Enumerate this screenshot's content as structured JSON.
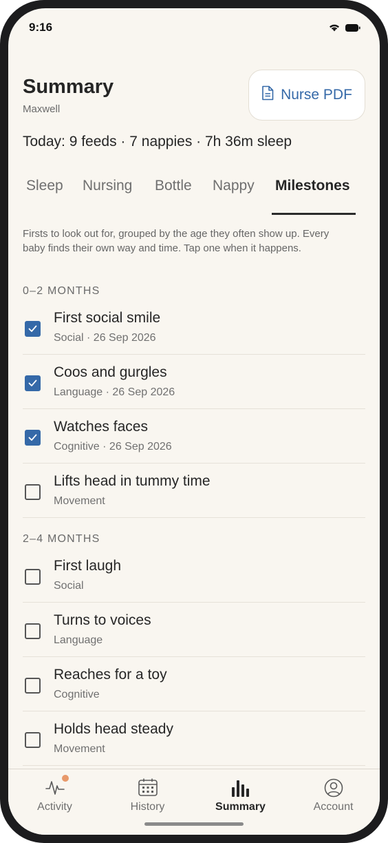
{
  "status": {
    "time": "9:16"
  },
  "header": {
    "title": "Summary",
    "subtitle": "Maxwell",
    "pdf_button": "Nurse PDF",
    "today": "Today: 9 feeds · 7 nappies · 7h 36m sleep"
  },
  "tabs": [
    {
      "label": "Sleep"
    },
    {
      "label": "Nursing"
    },
    {
      "label": "Bottle"
    },
    {
      "label": "Nappy"
    },
    {
      "label": "Milestones",
      "active": true
    }
  ],
  "intro": "Firsts to look out for, grouped by the age they often show up. Every baby finds their own way and time. Tap one when it happens.",
  "sections": [
    {
      "heading": "0–2 MONTHS",
      "items": [
        {
          "title": "First social smile",
          "meta": "Social · 26 Sep 2026",
          "checked": true
        },
        {
          "title": "Coos and gurgles",
          "meta": "Language · 26 Sep 2026",
          "checked": true
        },
        {
          "title": "Watches faces",
          "meta": "Cognitive · 26 Sep 2026",
          "checked": true
        },
        {
          "title": "Lifts head in tummy time",
          "meta": "Movement",
          "checked": false
        }
      ]
    },
    {
      "heading": "2–4 MONTHS",
      "items": [
        {
          "title": "First laugh",
          "meta": "Social",
          "checked": false
        },
        {
          "title": "Turns to voices",
          "meta": "Language",
          "checked": false
        },
        {
          "title": "Reaches for a toy",
          "meta": "Cognitive",
          "checked": false
        },
        {
          "title": "Holds head steady",
          "meta": "Movement",
          "checked": false
        }
      ]
    }
  ],
  "nav": [
    {
      "label": "Activity",
      "icon": "activity-icon",
      "badge": true
    },
    {
      "label": "History",
      "icon": "calendar-icon"
    },
    {
      "label": "Summary",
      "icon": "bar-chart-icon",
      "active": true
    },
    {
      "label": "Account",
      "icon": "account-icon"
    }
  ],
  "colors": {
    "accent": "#3569a8",
    "background": "#f9f6f0",
    "badge": "#e8996a"
  }
}
